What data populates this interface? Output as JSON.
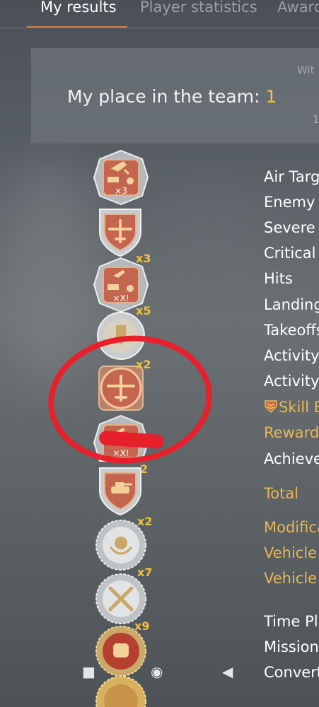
{
  "tabs": [
    {
      "label": "My results",
      "active": true
    },
    {
      "label": "Player statistics",
      "active": false
    },
    {
      "label": "Award",
      "active": false
    }
  ],
  "header": {
    "place_label": "My place in the team:",
    "place_value": "1",
    "corner_top": "Wit",
    "corner_bottom": "1"
  },
  "stats_rows": [
    {
      "label": "Air Targ",
      "color": "white"
    },
    {
      "label": "Enemy I",
      "color": "white"
    },
    {
      "label": "Severe d",
      "color": "white"
    },
    {
      "label": "Critical I",
      "color": "white"
    },
    {
      "label": "Hits",
      "color": "white"
    },
    {
      "label": "Landing",
      "color": "white"
    },
    {
      "label": "Takeoffs",
      "color": "white"
    },
    {
      "label": "Activity",
      "color": "white"
    },
    {
      "label": "Activity",
      "color": "white"
    },
    {
      "label": "Skill B",
      "color": "gold",
      "icon": "skill-bonus-icon"
    },
    {
      "label": "Reward",
      "color": "gold"
    },
    {
      "label": "Achieve",
      "color": "white"
    },
    {
      "label": "Total",
      "color": "gold"
    },
    {
      "label": "Modifica",
      "color": "gold"
    },
    {
      "label": "Vehicle",
      "color": "gold"
    },
    {
      "label": "Vehicle",
      "color": "gold"
    },
    {
      "label": "Time Pla",
      "color": "white"
    },
    {
      "label": "Missions",
      "color": "white"
    },
    {
      "label": "Convert",
      "color": "white"
    }
  ],
  "medals": [
    {
      "icon": "multi-kill-shield-icon",
      "mult": "×3",
      "inner": "×3"
    },
    {
      "icon": "plane-shield-icon",
      "mult": ""
    },
    {
      "icon": "multi-kill-shield-icon",
      "mult": "x3",
      "inner": "×X!"
    },
    {
      "icon": "bomb-round-icon",
      "mult": "x5"
    },
    {
      "icon": "plane-round-icon",
      "mult": "x2"
    },
    {
      "icon": "multi-kill-shield-icon",
      "mult": "",
      "inner": "×X!"
    },
    {
      "icon": "tank-shield-icon",
      "mult": "2"
    },
    {
      "icon": "bomb-wreath-icon",
      "mult": "x2"
    },
    {
      "icon": "crossed-swords-icon",
      "mult": "x7"
    },
    {
      "icon": "fist-icon",
      "mult": "x9"
    },
    {
      "icon": "gold-wreath-icon",
      "mult": ""
    }
  ],
  "navbar": {
    "recents": "■",
    "home": "◉",
    "back": "◀"
  },
  "colors": {
    "accent_tab": "#d7774a",
    "gold_text": "#e7b653",
    "highlight_circle": "#e8202b",
    "medal_red": "#c4664f",
    "medal_silver": "#c9ccce"
  }
}
